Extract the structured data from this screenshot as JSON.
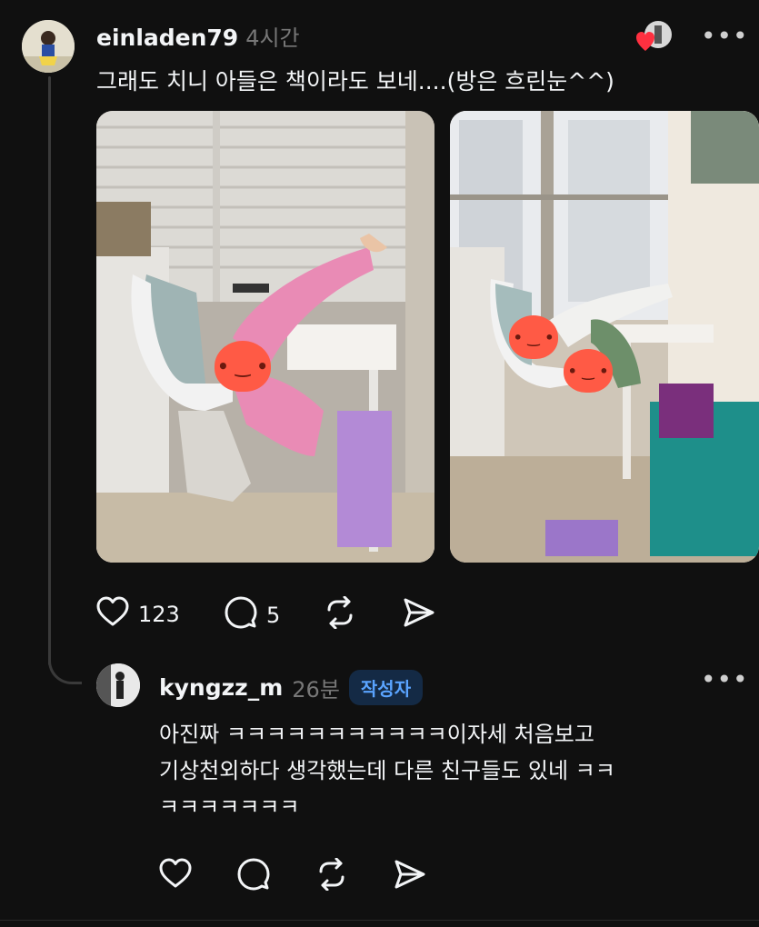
{
  "post": {
    "username": "einladen79",
    "time": "4시간",
    "text": "그래도 치니 아들은 책이라도 보네....(방은 흐린눈^^)",
    "more": "•••",
    "likes": "123",
    "comments": "5"
  },
  "reply": {
    "username": "kyngzz_m",
    "time": "26분",
    "badge": "작성자",
    "more": "•••",
    "lines": [
      "아진짜 ㅋㅋㅋㅋㅋㅋㅋㅋㅋㅋㅋ이자세 처음보고",
      "기상천외하다 생각했는데 다른 친구들도 있네 ㅋㅋ",
      "ㅋㅋㅋㅋㅋㅋㅋ"
    ]
  },
  "icons": {
    "like": "heart-icon",
    "comment": "speech-bubble-icon",
    "repost": "repost-icon",
    "share": "send-icon"
  },
  "colors": {
    "background": "#101010",
    "text": "#f3f5f7",
    "muted": "#777777",
    "badge_bg": "#142a45",
    "badge_text": "#5aa4ff",
    "heart_overlay": "#ff5a45"
  }
}
